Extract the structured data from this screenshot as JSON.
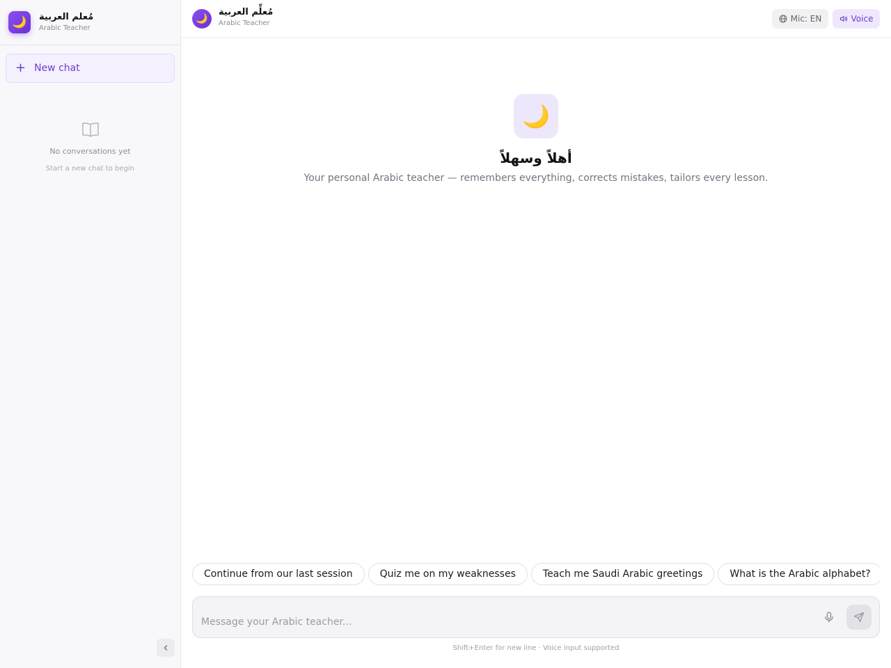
{
  "sidebar": {
    "logo_emoji": "🌙",
    "brand_arabic": "مُعلم العربية",
    "brand_english": "Arabic Teacher",
    "new_chat_icon": "+",
    "new_chat_label": "New chat",
    "empty_title": "No conversations yet",
    "empty_subtitle": "Start a new chat to begin"
  },
  "header": {
    "logo_emoji": "🌙",
    "title_arabic": "مُعلِّم العربية",
    "title_english": "Arabic Teacher",
    "mic_label": "Mic: EN",
    "voice_label": "Voice"
  },
  "hero": {
    "icon_emoji": "🌙",
    "title": "أهلاً وسهلاً",
    "subtitle": "Your personal Arabic teacher — remembers everything, corrects mistakes, tailors every lesson."
  },
  "suggestions": [
    "Continue from our last session",
    "Quiz me on my weaknesses",
    "Teach me Saudi Arabic greetings",
    "What is the Arabic alphabet?"
  ],
  "composer": {
    "placeholder": "Message your Arabic teacher...",
    "hint": "Shift+Enter for new line · Voice input supported"
  },
  "colors": {
    "accent": "#7c3aed",
    "accent_soft": "#ede7fc",
    "sidebar_bg": "#f8f8fb"
  }
}
